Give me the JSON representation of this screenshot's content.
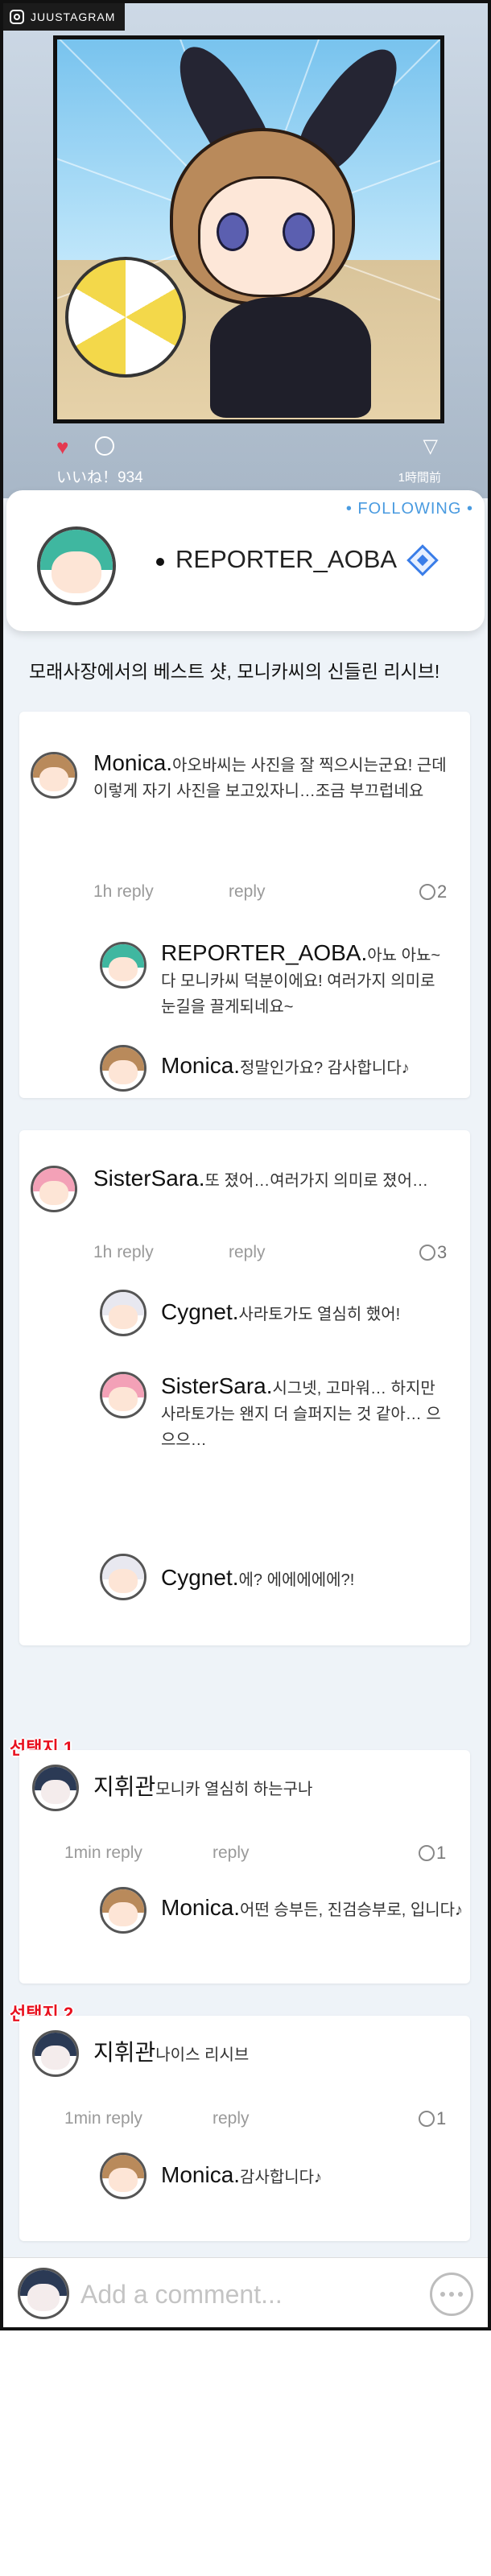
{
  "app": {
    "name": "JUUSTAGRAM"
  },
  "post": {
    "likes": "いいね！934",
    "time": "1時間前",
    "author": "REPORTER_AOBA",
    "follow_status": "• FOLLOWING •",
    "caption": "모래사장에서의 베스트 샷, 모니카씨의 신들린 리시브!"
  },
  "threads": [
    {
      "user": "Monica.",
      "text": "아오바씨는 사진을 잘 찍으시는군요! 근데 이렇게 자기 사진을 보고있자니…조금 부끄럽네요",
      "time": "1h reply",
      "reply_label": "reply",
      "replies": "2",
      "children": [
        {
          "user": "REPORTER_AOBA.",
          "text": "아뇨 아뇨~ 다 모니카씨 덕분이에요! 여러가지 의미로 눈길을 끌게되네요~"
        },
        {
          "user": "Monica.",
          "text": "정말인가요? 감사합니다♪"
        }
      ]
    },
    {
      "user": "SisterSara.",
      "text": "또 졌어…여러가지 의미로 졌어…",
      "time": "1h reply",
      "reply_label": "reply",
      "replies": "3",
      "children": [
        {
          "user": "Cygnet.",
          "text": "사라토가도 열심히 했어!"
        },
        {
          "user": "SisterSara.",
          "text": "시그넷, 고마워… 하지만 사라토가는 왠지 더 슬퍼지는 것 같아… 으으으…"
        },
        {
          "user": "Cygnet.",
          "text": "에? 에에에에에?!"
        }
      ]
    },
    {
      "tag": "선택지 1",
      "user": "지휘관",
      "text": "모니카 열심히 하는구나",
      "time": "1min reply",
      "reply_label": "reply",
      "replies": "1",
      "children": [
        {
          "user": "Monica.",
          "text": "어떤 승부든, 진검승부로, 입니다♪"
        }
      ]
    },
    {
      "tag": "선택지 2",
      "user": "지휘관",
      "text": "나이스 리시브",
      "time": "1min reply",
      "reply_label": "reply",
      "replies": "1",
      "children": [
        {
          "user": "Monica.",
          "text": "감사합니다♪"
        }
      ]
    }
  ],
  "comment_input": {
    "placeholder": "Add a comment..."
  },
  "colors": {
    "like": "#e53950",
    "following": "#4a9be0",
    "choice_tag": "#e8101e",
    "verified": "#3a7de8"
  }
}
